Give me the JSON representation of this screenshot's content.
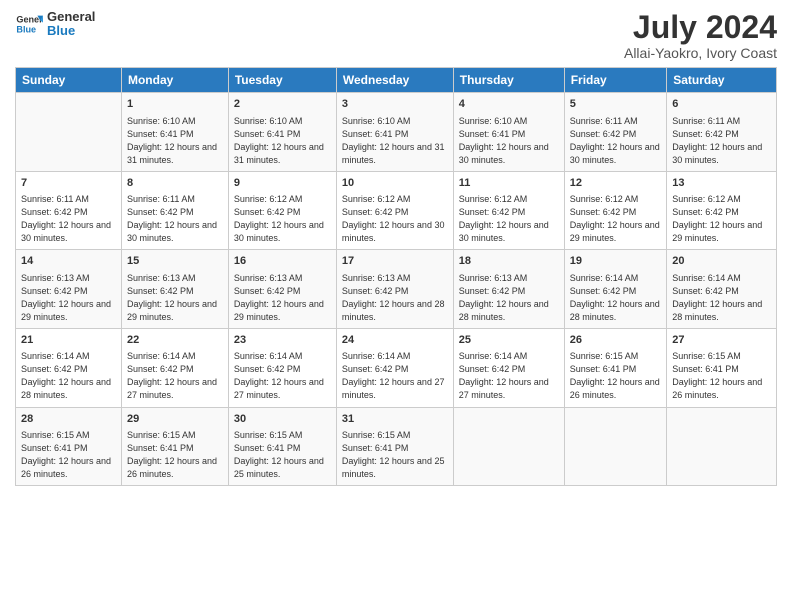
{
  "logo": {
    "line1": "General",
    "line2": "Blue"
  },
  "title": "July 2024",
  "subtitle": "Allai-Yaokro, Ivory Coast",
  "days_of_week": [
    "Sunday",
    "Monday",
    "Tuesday",
    "Wednesday",
    "Thursday",
    "Friday",
    "Saturday"
  ],
  "weeks": [
    [
      {
        "day": "",
        "sunrise": "",
        "sunset": "",
        "daylight": ""
      },
      {
        "day": "1",
        "sunrise": "6:10 AM",
        "sunset": "6:41 PM",
        "daylight": "12 hours and 31 minutes."
      },
      {
        "day": "2",
        "sunrise": "6:10 AM",
        "sunset": "6:41 PM",
        "daylight": "12 hours and 31 minutes."
      },
      {
        "day": "3",
        "sunrise": "6:10 AM",
        "sunset": "6:41 PM",
        "daylight": "12 hours and 31 minutes."
      },
      {
        "day": "4",
        "sunrise": "6:10 AM",
        "sunset": "6:41 PM",
        "daylight": "12 hours and 30 minutes."
      },
      {
        "day": "5",
        "sunrise": "6:11 AM",
        "sunset": "6:42 PM",
        "daylight": "12 hours and 30 minutes."
      },
      {
        "day": "6",
        "sunrise": "6:11 AM",
        "sunset": "6:42 PM",
        "daylight": "12 hours and 30 minutes."
      }
    ],
    [
      {
        "day": "7",
        "sunrise": "6:11 AM",
        "sunset": "6:42 PM",
        "daylight": "12 hours and 30 minutes."
      },
      {
        "day": "8",
        "sunrise": "6:11 AM",
        "sunset": "6:42 PM",
        "daylight": "12 hours and 30 minutes."
      },
      {
        "day": "9",
        "sunrise": "6:12 AM",
        "sunset": "6:42 PM",
        "daylight": "12 hours and 30 minutes."
      },
      {
        "day": "10",
        "sunrise": "6:12 AM",
        "sunset": "6:42 PM",
        "daylight": "12 hours and 30 minutes."
      },
      {
        "day": "11",
        "sunrise": "6:12 AM",
        "sunset": "6:42 PM",
        "daylight": "12 hours and 30 minutes."
      },
      {
        "day": "12",
        "sunrise": "6:12 AM",
        "sunset": "6:42 PM",
        "daylight": "12 hours and 29 minutes."
      },
      {
        "day": "13",
        "sunrise": "6:12 AM",
        "sunset": "6:42 PM",
        "daylight": "12 hours and 29 minutes."
      }
    ],
    [
      {
        "day": "14",
        "sunrise": "6:13 AM",
        "sunset": "6:42 PM",
        "daylight": "12 hours and 29 minutes."
      },
      {
        "day": "15",
        "sunrise": "6:13 AM",
        "sunset": "6:42 PM",
        "daylight": "12 hours and 29 minutes."
      },
      {
        "day": "16",
        "sunrise": "6:13 AM",
        "sunset": "6:42 PM",
        "daylight": "12 hours and 29 minutes."
      },
      {
        "day": "17",
        "sunrise": "6:13 AM",
        "sunset": "6:42 PM",
        "daylight": "12 hours and 28 minutes."
      },
      {
        "day": "18",
        "sunrise": "6:13 AM",
        "sunset": "6:42 PM",
        "daylight": "12 hours and 28 minutes."
      },
      {
        "day": "19",
        "sunrise": "6:14 AM",
        "sunset": "6:42 PM",
        "daylight": "12 hours and 28 minutes."
      },
      {
        "day": "20",
        "sunrise": "6:14 AM",
        "sunset": "6:42 PM",
        "daylight": "12 hours and 28 minutes."
      }
    ],
    [
      {
        "day": "21",
        "sunrise": "6:14 AM",
        "sunset": "6:42 PM",
        "daylight": "12 hours and 28 minutes."
      },
      {
        "day": "22",
        "sunrise": "6:14 AM",
        "sunset": "6:42 PM",
        "daylight": "12 hours and 27 minutes."
      },
      {
        "day": "23",
        "sunrise": "6:14 AM",
        "sunset": "6:42 PM",
        "daylight": "12 hours and 27 minutes."
      },
      {
        "day": "24",
        "sunrise": "6:14 AM",
        "sunset": "6:42 PM",
        "daylight": "12 hours and 27 minutes."
      },
      {
        "day": "25",
        "sunrise": "6:14 AM",
        "sunset": "6:42 PM",
        "daylight": "12 hours and 27 minutes."
      },
      {
        "day": "26",
        "sunrise": "6:15 AM",
        "sunset": "6:41 PM",
        "daylight": "12 hours and 26 minutes."
      },
      {
        "day": "27",
        "sunrise": "6:15 AM",
        "sunset": "6:41 PM",
        "daylight": "12 hours and 26 minutes."
      }
    ],
    [
      {
        "day": "28",
        "sunrise": "6:15 AM",
        "sunset": "6:41 PM",
        "daylight": "12 hours and 26 minutes."
      },
      {
        "day": "29",
        "sunrise": "6:15 AM",
        "sunset": "6:41 PM",
        "daylight": "12 hours and 26 minutes."
      },
      {
        "day": "30",
        "sunrise": "6:15 AM",
        "sunset": "6:41 PM",
        "daylight": "12 hours and 25 minutes."
      },
      {
        "day": "31",
        "sunrise": "6:15 AM",
        "sunset": "6:41 PM",
        "daylight": "12 hours and 25 minutes."
      },
      {
        "day": "",
        "sunrise": "",
        "sunset": "",
        "daylight": ""
      },
      {
        "day": "",
        "sunrise": "",
        "sunset": "",
        "daylight": ""
      },
      {
        "day": "",
        "sunrise": "",
        "sunset": "",
        "daylight": ""
      }
    ]
  ]
}
